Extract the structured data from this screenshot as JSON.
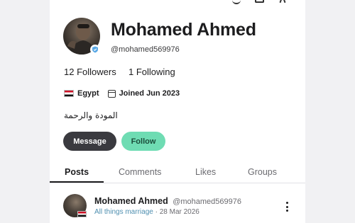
{
  "profile": {
    "name": "Mohamed Ahmed",
    "handle": "@mohamed569976",
    "followers_count": "12",
    "followers_label": "Followers",
    "following_count": "1",
    "following_label": "Following",
    "country": "Egypt",
    "joined": "Joined Jun 2023",
    "bio": "المودة والرحمة"
  },
  "actions": {
    "message_label": "Message",
    "follow_label": "Follow"
  },
  "tabs": [
    {
      "label": "Posts",
      "active": true
    },
    {
      "label": "Comments",
      "active": false
    },
    {
      "label": "Likes",
      "active": false
    },
    {
      "label": "Groups",
      "active": false
    }
  ],
  "post": {
    "author": "Mohamed Ahmed",
    "handle": "@mohamed569976",
    "group": "All things marriage",
    "separator": "·",
    "date": "28 Mar 2026"
  },
  "colors": {
    "follow_button": "#6fdcb3",
    "message_button": "#3a3a3f",
    "group_link": "#4f8fb0"
  }
}
